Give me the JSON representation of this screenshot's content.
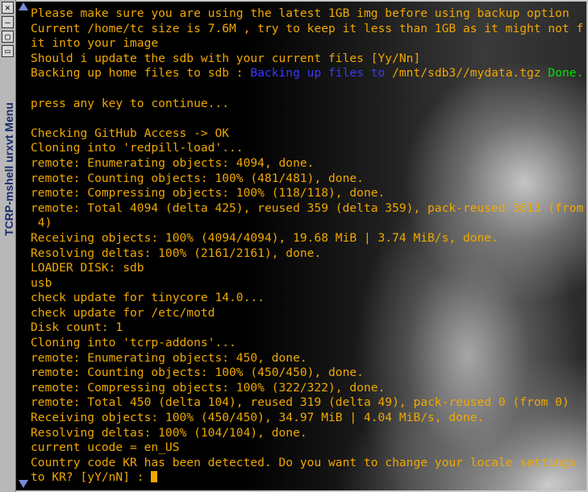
{
  "window": {
    "title": "TCRP-mshell urxvt",
    "menu_label": "Menu",
    "buttons": [
      "close-icon",
      "minimize-icon",
      "maximize-icon"
    ]
  },
  "colors": {
    "text": "#f0a800",
    "blue": "#3a3aff",
    "green": "#00e000",
    "titlebar": "#b8b8b8"
  },
  "terminal": {
    "lines": [
      "Please make sure you are using the latest 1GB img before using backup option",
      "Current /home/tc size is 7.6M , try to keep it less than 1GB as it might not f",
      "it into your image",
      "Should i update the sdb with your current files [Yy/Nn]",
      "",
      "",
      "press any key to continue...",
      "",
      "Checking GitHub Access -> OK",
      "Cloning into 'redpill-load'...",
      "remote: Enumerating objects: 4094, done.",
      "remote: Counting objects: 100% (481/481), done.",
      "remote: Compressing objects: 100% (118/118), done.",
      "remote: Total 4094 (delta 425), reused 359 (delta 359), pack-reused 3613 (from",
      " 4)",
      "Receiving objects: 100% (4094/4094), 19.68 MiB | 3.74 MiB/s, done.",
      "Resolving deltas: 100% (2161/2161), done.",
      "LOADER DISK: sdb",
      "usb",
      "check update for tinycore 14.0...",
      "check update for /etc/motd",
      "Disk count: 1",
      "Cloning into 'tcrp-addons'...",
      "remote: Enumerating objects: 450, done.",
      "remote: Counting objects: 100% (450/450), done.",
      "remote: Compressing objects: 100% (322/322), done.",
      "remote: Total 450 (delta 104), reused 319 (delta 49), pack-reused 0 (from 0)",
      "Receiving objects: 100% (450/450), 34.97 MiB | 4.04 MiB/s, done.",
      "Resolving deltas: 100% (104/104), done.",
      "current ucode = en_US",
      "Country code KR has been detected. Do you want to change your locale settings"
    ],
    "backup_line": {
      "prefix": "Backing up home files to sdb : ",
      "blue_part": "Backing up files to ",
      "path": "/mnt/sdb3//mydata.tgz",
      "status": " Done."
    },
    "prompt_line": "to KR? [yY/nN] : "
  }
}
